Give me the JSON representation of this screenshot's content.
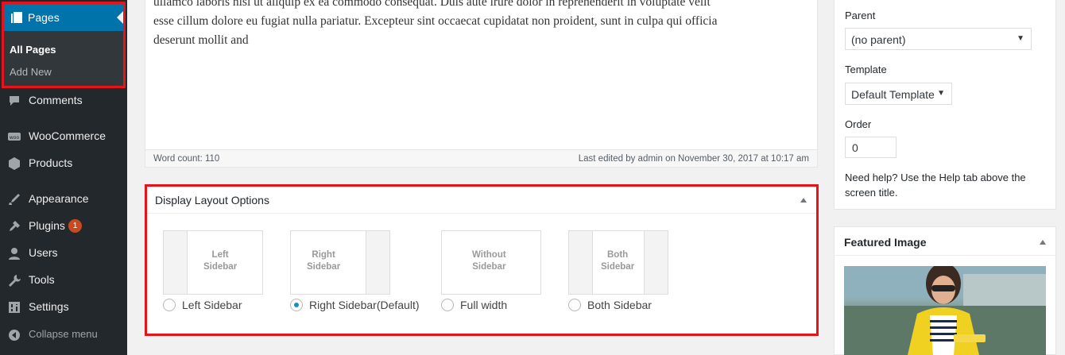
{
  "sidebar": {
    "pages": {
      "label": "Pages",
      "icon": "pages-icon"
    },
    "submenu": [
      {
        "label": "All Pages",
        "current": true
      },
      {
        "label": "Add New",
        "current": false
      }
    ],
    "items": [
      {
        "label": "Comments",
        "icon": "comments-icon"
      },
      {
        "label": "WooCommerce",
        "icon": "woocommerce-icon"
      },
      {
        "label": "Products",
        "icon": "products-icon"
      },
      {
        "label": "Appearance",
        "icon": "appearance-icon"
      },
      {
        "label": "Plugins",
        "icon": "plugins-icon",
        "badge": "1"
      },
      {
        "label": "Users",
        "icon": "users-icon"
      },
      {
        "label": "Tools",
        "icon": "tools-icon"
      },
      {
        "label": "Settings",
        "icon": "settings-icon"
      }
    ],
    "collapse": "Collapse menu"
  },
  "editor": {
    "line1": "ullamco laboris nisi ut aliquip ex ea commodo consequat. Duis aute irure dolor in reprehenderit in voluptate velit",
    "line2": "esse cillum dolore eu fugiat nulla pariatur. Excepteur sint occaecat cupidatat non proident, sunt in culpa qui officia",
    "line3": "deserunt mollit and",
    "word_count": "Word count: 110",
    "last_edited": "Last edited by admin on November 30, 2017 at 10:17 am"
  },
  "layout_options": {
    "title": "Display Layout Options",
    "options": [
      {
        "thumb_line1": "Left",
        "thumb_line2": "Sidebar",
        "label": "Left Sidebar",
        "selected": false
      },
      {
        "thumb_line1": "Right",
        "thumb_line2": "Sidebar",
        "label": "Right Sidebar(Default)",
        "selected": true
      },
      {
        "thumb_line1": "Without",
        "thumb_line2": "Sidebar",
        "label": "Full width",
        "selected": false
      },
      {
        "thumb_line1": "Both",
        "thumb_line2": "Sidebar",
        "label": "Both Sidebar",
        "selected": false
      }
    ]
  },
  "page_attributes": {
    "parent_label": "Parent",
    "parent_value": "(no parent)",
    "template_label": "Template",
    "template_value": "Default Template",
    "order_label": "Order",
    "order_value": "0",
    "help": "Need help? Use the Help tab above the screen title."
  },
  "featured_image": {
    "title": "Featured Image"
  },
  "colors": {
    "admin_bg": "#23282d",
    "accent": "#0073aa",
    "highlight_border": "#e8121a",
    "badge": "#ca4a1f"
  }
}
